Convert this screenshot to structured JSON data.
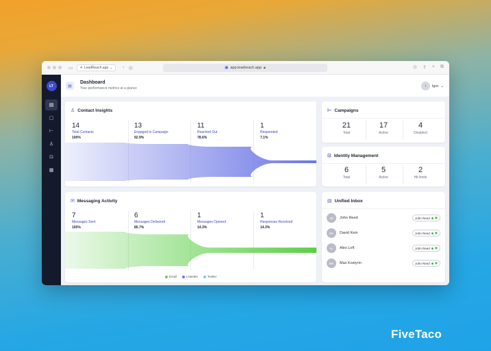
{
  "browser": {
    "tab_label": "LeadReach.app",
    "url": "app.leadreach.app"
  },
  "sidebar": {
    "avatar_initials": "LT",
    "items": [
      {
        "icon": "dashboard-icon",
        "active": true
      },
      {
        "icon": "chat-icon",
        "active": false
      },
      {
        "icon": "campaign-flow-icon",
        "active": false
      },
      {
        "icon": "contacts-icon",
        "active": false
      },
      {
        "icon": "inbox-icon",
        "active": false
      },
      {
        "icon": "grid-icon",
        "active": false
      }
    ]
  },
  "header": {
    "title": "Dashboard",
    "subtitle": "Your performance metrics at a glance",
    "user_initial": "I",
    "user_name": "Igor"
  },
  "contact_insights": {
    "title": "Contact Insights",
    "stats": [
      {
        "value": "14",
        "label": "Total Contacts",
        "pct": "100%"
      },
      {
        "value": "13",
        "label": "Engaged in Campaign",
        "pct": "92.9%"
      },
      {
        "value": "11",
        "label": "Reached Out",
        "pct": "78.6%"
      },
      {
        "value": "1",
        "label": "Responded",
        "pct": "7.1%"
      }
    ],
    "color": "#6b76e6"
  },
  "messaging_activity": {
    "title": "Messaging Activity",
    "stats": [
      {
        "value": "7",
        "label": "Messages Sent",
        "pct": "100%"
      },
      {
        "value": "6",
        "label": "Messages Delivered",
        "pct": "85.7%"
      },
      {
        "value": "1",
        "label": "Messages Opened",
        "pct": "14.3%"
      },
      {
        "value": "1",
        "label": "Responses Received",
        "pct": "14.3%"
      }
    ],
    "legend": [
      "Email",
      "LinkedIn",
      "Twitter"
    ],
    "legend_colors": [
      "#6ccf5a",
      "#6b76e6",
      "#7cc6f0"
    ],
    "color": "#5ccf46"
  },
  "campaigns": {
    "title": "Campaigns",
    "stats": [
      {
        "value": "21",
        "label": "Total"
      },
      {
        "value": "17",
        "label": "Active"
      },
      {
        "value": "4",
        "label": "Disabled"
      }
    ]
  },
  "identity": {
    "title": "Identity Management",
    "stats": [
      {
        "value": "6",
        "label": "Total"
      },
      {
        "value": "5",
        "label": "Active"
      },
      {
        "value": "2",
        "label": "Hit limits"
      }
    ]
  },
  "inbox": {
    "title": "Unified Inbox",
    "rows": [
      {
        "initials": "JR",
        "name": "John Reed",
        "tag": "John Reed"
      },
      {
        "initials": "DK",
        "name": "David Kein",
        "tag": "John Reed"
      },
      {
        "initials": "AL",
        "name": "Alex Loft",
        "tag": "John Reed"
      },
      {
        "initials": "MK",
        "name": "Max Kostyrin",
        "tag": "John Reed"
      }
    ]
  },
  "brand": "FiveTaco"
}
